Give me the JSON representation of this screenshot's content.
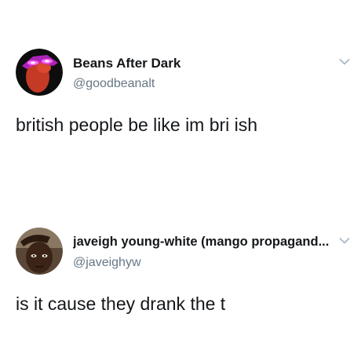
{
  "tweets": [
    {
      "display_name": "Beans After Dark",
      "handle": "@goodbeanalt",
      "text": "british people be like im bri ish",
      "avatar_icon": "bean-with-glowing-eyes-avatar",
      "menu_icon": "chevron-down-icon"
    },
    {
      "display_name": "javeigh young-white (mango propagand...",
      "handle": "@javeighyw",
      "text": "is it cause they drank the t",
      "avatar_icon": "person-photo-avatar",
      "menu_icon": "chevron-down-icon"
    }
  ],
  "colors": {
    "name": "#14171a",
    "handle": "#657786",
    "chevron": "#aab8c2",
    "background": "#ffffff"
  }
}
